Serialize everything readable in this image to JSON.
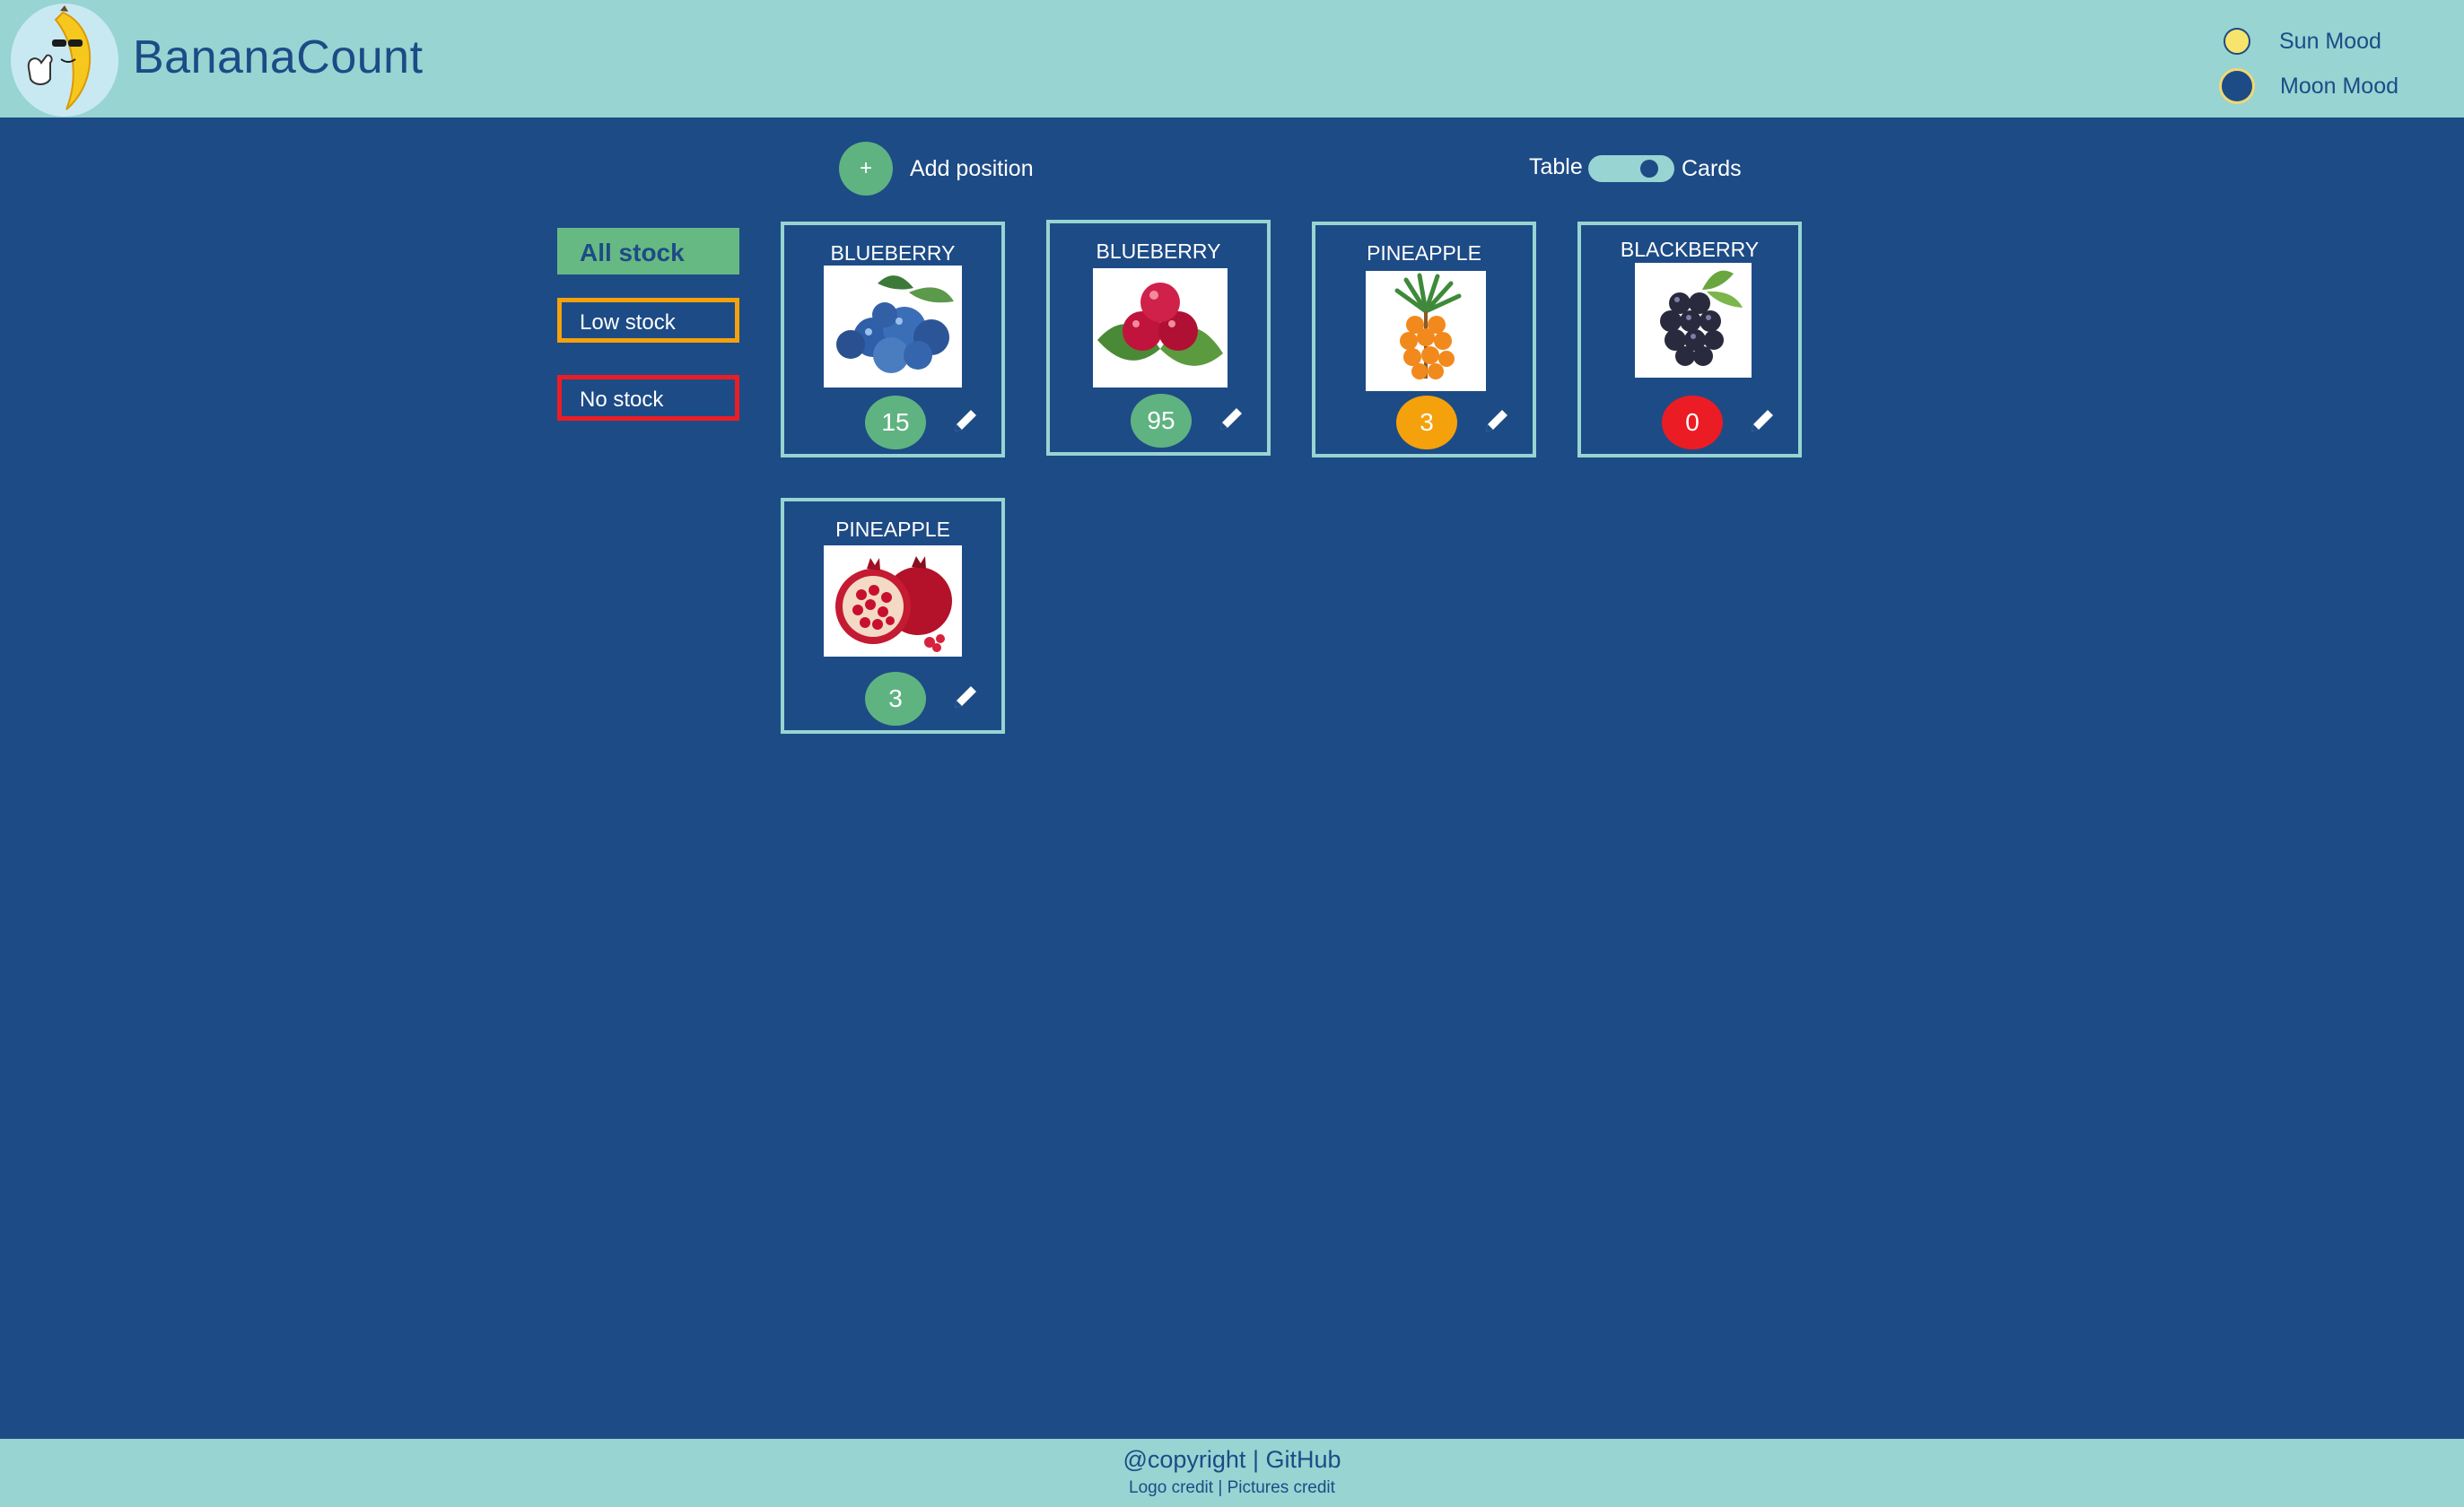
{
  "header": {
    "app_title": "BananaCount",
    "logo_icon": "banana-mascot-logo",
    "moods": [
      {
        "label": "Sun Mood",
        "color": "#f7e46c"
      },
      {
        "label": "Moon Mood",
        "color": "#1d4b86"
      }
    ]
  },
  "toolbar": {
    "add_symbol": "+",
    "add_label": "Add position",
    "view_table_label": "Table",
    "view_cards_label": "Cards",
    "view_selected": "Cards"
  },
  "filters": {
    "all": "All stock",
    "low": "Low stock",
    "none": "No stock"
  },
  "cards": [
    {
      "name": "BLUEBERRY",
      "count": "15",
      "status": "in-stock",
      "image": "blueberry-image"
    },
    {
      "name": "BLUEBERRY",
      "count": "95",
      "status": "in-stock",
      "image": "cranberry-image"
    },
    {
      "name": "PINEAPPLE",
      "count": "3",
      "status": "low-stock",
      "image": "sea-buckthorn-image"
    },
    {
      "name": "BLACKBERRY",
      "count": "0",
      "status": "no-stock",
      "image": "blackberry-image"
    },
    {
      "name": "PINEAPPLE",
      "count": "3",
      "status": "in-stock",
      "image": "pomegranate-image"
    }
  ],
  "footer": {
    "copyright": "@copyright",
    "separator": "|",
    "github": "GitHub",
    "logo_credit": "Logo credit",
    "pictures_credit": "Pictures credit"
  },
  "colors": {
    "background": "#1d4b86",
    "header_footer": "#98d4d2",
    "in_stock": "#5fb381",
    "low_stock": "#f4a10c",
    "no_stock": "#ec1c24"
  }
}
